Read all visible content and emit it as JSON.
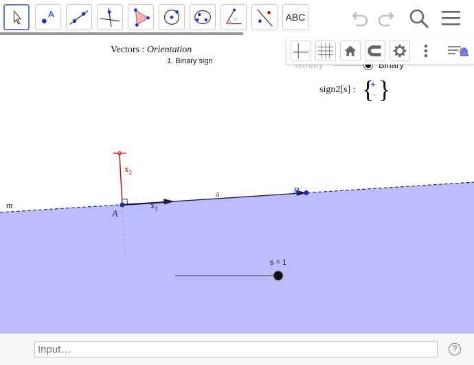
{
  "toolbar": {
    "text_tool_label": "ABC",
    "tools": [
      {
        "name": "move-tool-icon"
      },
      {
        "name": "point-tool-icon"
      },
      {
        "name": "line-tool-icon"
      },
      {
        "name": "perpendicular-line-tool-icon"
      },
      {
        "name": "polygon-tool-icon"
      },
      {
        "name": "circle-tool-icon"
      },
      {
        "name": "ellipse-tool-icon"
      },
      {
        "name": "angle-tool-icon"
      },
      {
        "name": "reflect-tool-icon"
      },
      {
        "name": "text-tool-icon"
      }
    ],
    "undo_icon": "undo-icon",
    "redo_icon": "redo-icon",
    "search_icon": "search-icon",
    "menu_icon": "menu-icon"
  },
  "graphics": {
    "title_plain": "Vectors : ",
    "title_italic": "Orientation",
    "subtitle": "1.  Binary  sign",
    "radio_ternary": "Ternary",
    "radio_binary": "Binary",
    "sign_label": "sign2[s] : ",
    "sign_plus": "+",
    "sign_minus": "−",
    "line_label_m": "m",
    "point_A": "A",
    "point_B": "B",
    "vector_label_a": "a",
    "x1_label": "x",
    "x1_sub": "1",
    "x2_label": "x",
    "x2_sub": "2",
    "slider_label": "s = 1",
    "slider_value": 1,
    "colors": {
      "half_plane": "#bcbcff",
      "vector_red": "#cc0000",
      "vector_dark": "#1a1a4a",
      "point_blue": "#1a2fd6"
    }
  },
  "style_bar": {
    "buttons": [
      {
        "name": "axes-toggle-icon"
      },
      {
        "name": "grid-toggle-icon"
      },
      {
        "name": "home-view-icon"
      },
      {
        "name": "magnet-snap-icon"
      },
      {
        "name": "settings-gear-icon"
      },
      {
        "name": "more-vertical-icon"
      },
      {
        "name": "style-bar-toggle-icon"
      }
    ]
  },
  "input_bar": {
    "placeholder": "Input…",
    "help": "?"
  }
}
